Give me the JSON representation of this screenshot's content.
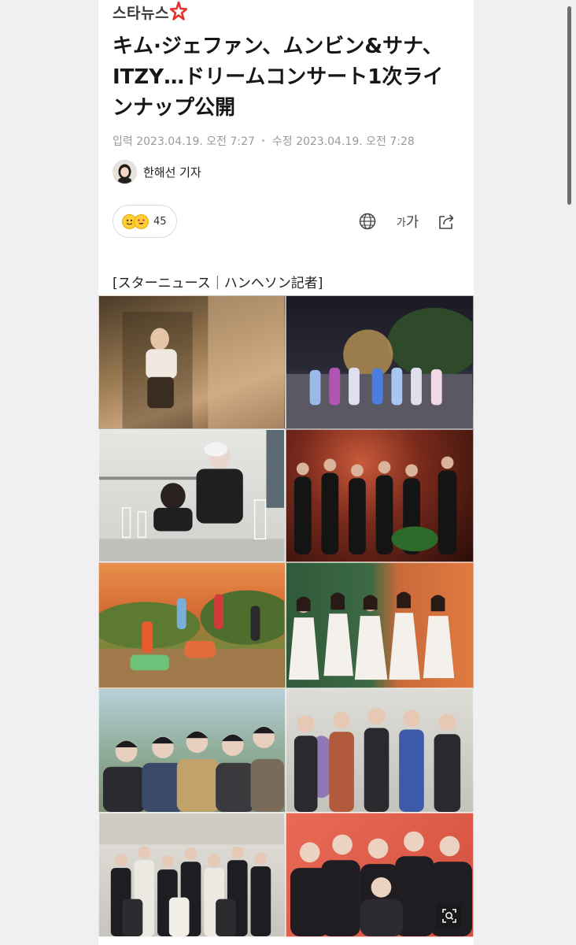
{
  "brand": {
    "name": "스타뉴스",
    "accent": "#e5322d"
  },
  "article": {
    "title": "キム·ジェファン、ムンビン&サナ、ITZY…ドリームコンサート1次ラインナップ公開",
    "meta": {
      "input_label": "입력",
      "input_time": "2023.04.19. 오전 7:27",
      "modified_label": "수정",
      "modified_time": "2023.04.19. 오전 7:28"
    },
    "reporter": "한해선 기자",
    "reactions": {
      "count": "45"
    },
    "tools": {
      "language_icon": "globe-icon",
      "font_size_small": "가",
      "font_size_large": "가",
      "share_icon": "share-icon"
    },
    "caption": "[スターニュース｜ハンヘソン記者]"
  },
  "photos": [
    {
      "label": "artist-photo-1",
      "bg": "#8a6a48"
    },
    {
      "label": "artist-photo-2",
      "bg": "#2c2b36"
    },
    {
      "label": "artist-photo-3",
      "bg": "#d8d8d4"
    },
    {
      "label": "artist-photo-4",
      "bg": "#5a1d14"
    },
    {
      "label": "artist-photo-5",
      "bg": "#d2743a"
    },
    {
      "label": "artist-photo-6",
      "bg": "#b85d2e"
    },
    {
      "label": "artist-photo-7",
      "bg": "#9eb6c2"
    },
    {
      "label": "artist-photo-8",
      "bg": "#cdcdc9"
    },
    {
      "label": "artist-photo-9",
      "bg": "#d9d7d2"
    },
    {
      "label": "artist-photo-10",
      "bg": "#e26c58"
    }
  ]
}
